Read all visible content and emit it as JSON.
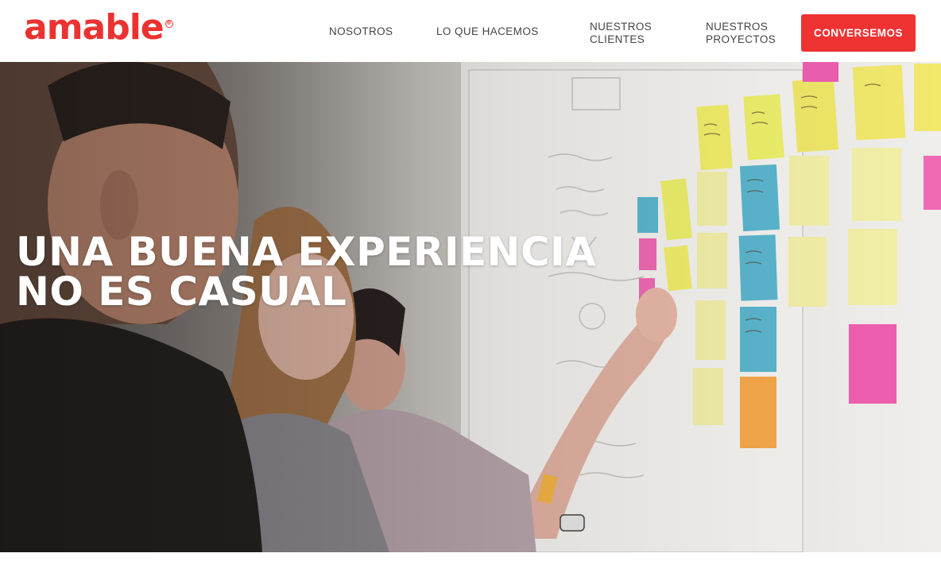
{
  "header": {
    "logo_text": "amable",
    "logo_mark": "®",
    "nav": {
      "nosotros": "NOSOTROS",
      "hacemos": "LO QUE HACEMOS",
      "clientes_l1": "NUESTROS",
      "clientes_l2": "CLIENTES",
      "proyectos_l1": "NUESTROS",
      "proyectos_l2": "PROYECTOS"
    },
    "cta_label": "CONVERSEMOS"
  },
  "hero": {
    "title_line1": "UNA BUENA EXPERIENCIA",
    "title_line2": "NO ES CASUAL",
    "image": "team-placing-sticky-notes-on-whiteboard"
  },
  "colors": {
    "brand_red": "#ea3331",
    "nav_text": "#444444",
    "hero_text": "#ffffff",
    "note_yellow": "#f3ee6a",
    "note_teal": "#5bb7cf",
    "note_pink": "#f05fb0",
    "note_orange": "#f7a94a"
  }
}
